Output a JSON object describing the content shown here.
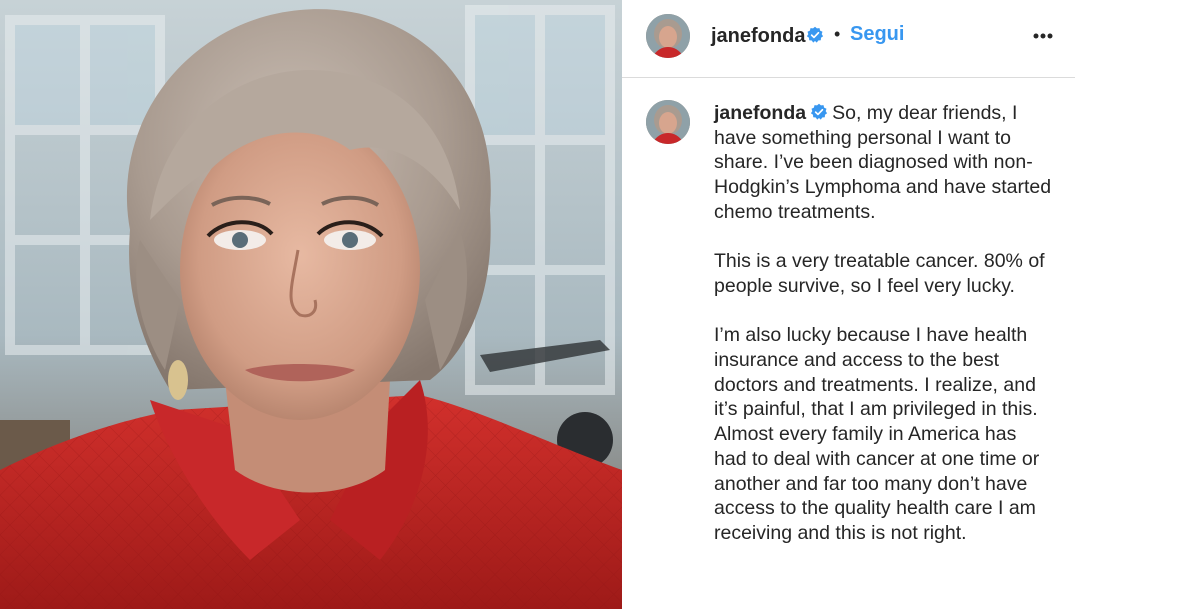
{
  "post": {
    "username": "janefonda",
    "verified": true,
    "separator": "•",
    "follow_label": "Segui",
    "more_icon": "more-horizontal-icon",
    "verified_icon": "verified-badge-icon",
    "accent_color": "#3897f0"
  },
  "caption": {
    "username": "janefonda",
    "paragraphs": [
      "So, my dear friends, I have something personal I want to share. I’ve been diagnosed with non-Hodgkin’s Lymphoma and have started chemo treatments.",
      "This is a very treatable cancer. 80% of people survive, so I feel very lucky.",
      "I’m also lucky because I have health insurance and access to the best doctors and treatments. I realize, and it’s painful, that I am privileged in this. Almost every family in America has had to deal with cancer at one time or another and far too many don’t have access to the quality health care I am receiving and this is not right."
    ]
  }
}
